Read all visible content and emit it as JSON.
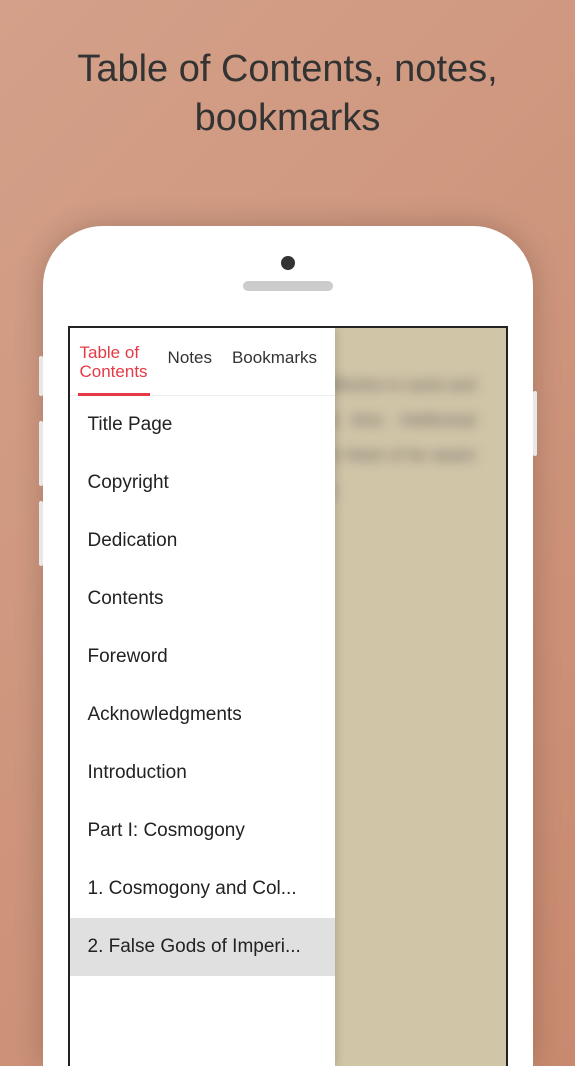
{
  "promo": {
    "title_line1": "Table of Contents, notes,",
    "title_line2": "bookmarks"
  },
  "tabs": {
    "toc": "Table of\nContents",
    "notes": "Notes",
    "bookmarks": "Bookmarks"
  },
  "toc_items": [
    {
      "label": "Title Page",
      "selected": false
    },
    {
      "label": "Copyright",
      "selected": false
    },
    {
      "label": "Dedication",
      "selected": false
    },
    {
      "label": "Contents",
      "selected": false
    },
    {
      "label": "Foreword",
      "selected": false
    },
    {
      "label": "Acknowledgments",
      "selected": false
    },
    {
      "label": "Introduction",
      "selected": false
    },
    {
      "label": "Part I: Cosmogony",
      "selected": false
    },
    {
      "label": "1. Cosmogony and Col...",
      "selected": false
    },
    {
      "label": "2. False Gods of Imperi...",
      "selected": true
    }
  ],
  "blurred_text": "onrad tics, media, an collective effective in racist and c discourse ily induced same time, intellectual European begins his published in Heart of be aware of in part, by onrad was a sudden"
}
